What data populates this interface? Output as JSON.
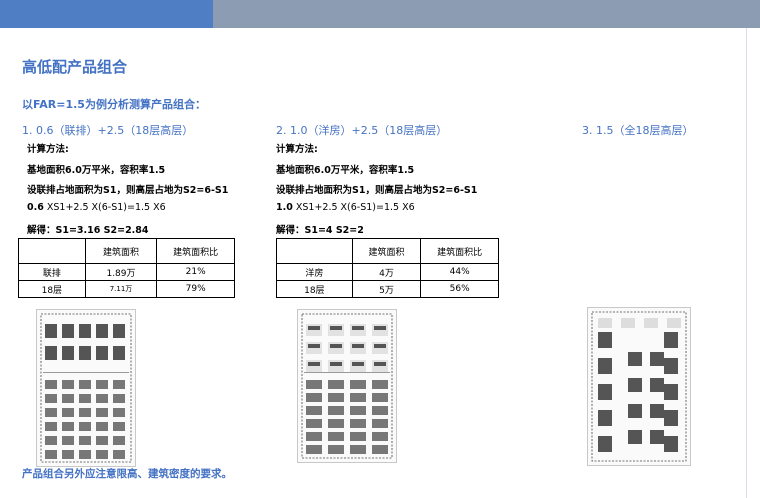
{
  "title": "高低配产品组合",
  "subtitle": "以FAR=1.5为例分析测算产品组合：",
  "col1": {
    "heading": "1.  0.6（联排）+2.5（18层高层）",
    "method_label": "计算方法:",
    "base_line": "基地面积6.0万平米，容积率1.5",
    "setup_line": "设联排占地面积为S1，则高层占地为S2=6-S1",
    "eq_coef": "0.6",
    "eq_rest": " XS1+2.5 X(6-S1)=1.5 X6",
    "solution": "解得：S1=3.16    S2=2.84",
    "table": {
      "headers": [
        "",
        "建筑面积",
        "建筑面积比"
      ],
      "rows": [
        [
          "联排",
          "1.89万",
          "21%"
        ],
        [
          "18层",
          "7.11万",
          "79%"
        ]
      ]
    }
  },
  "col2": {
    "heading": "2.   1.0（洋房）+2.5（18层高层）",
    "method_label": "计算方法:",
    "base_line": "基地面积6.0万平米，容积率1.5",
    "setup_line": "设联排占地面积为S1，则高层占地为S2=6-S1",
    "eq_coef": "1.0",
    "eq_rest": " XS1+2.5 X(6-S1)=1.5 X6",
    "solution": "解得：S1=4    S2=2",
    "table": {
      "headers": [
        "",
        "建筑面积",
        "建筑面积比"
      ],
      "rows": [
        [
          "洋房",
          "4万",
          "44%"
        ],
        [
          "18层",
          "5万",
          "56%"
        ]
      ]
    }
  },
  "col3": {
    "heading": "3.   1.5（全18层高层）"
  },
  "footnote": "产品组合另外应注意限高、建筑密度的要求。",
  "colors": {
    "accent": "#4472c4",
    "topbar_left": "#4f7ec4",
    "topbar_right": "#8c9cb3",
    "building": "#555555"
  }
}
